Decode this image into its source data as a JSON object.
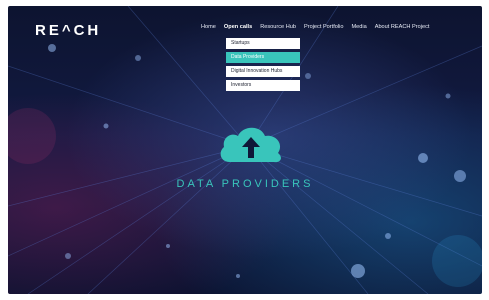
{
  "brand": {
    "logo_text": "RE^CH"
  },
  "nav": {
    "items": [
      {
        "label": "Home"
      },
      {
        "label": "Open calls"
      },
      {
        "label": "Resource Hub"
      },
      {
        "label": "Project Portfolio"
      },
      {
        "label": "Media"
      },
      {
        "label": "About REACH Project"
      }
    ],
    "active_index": 1
  },
  "dropdown": {
    "items": [
      {
        "label": "Startups"
      },
      {
        "label": "Data Providers"
      },
      {
        "label": "Digital Innovation Hubs"
      },
      {
        "label": "Investors"
      }
    ],
    "active_index": 1
  },
  "hero": {
    "icon": "cloud-upload-icon",
    "title": "DATA PROVIDERS"
  },
  "colors": {
    "accent": "#39c5bb",
    "background": "#0f1738",
    "text_light": "#ffffff"
  }
}
